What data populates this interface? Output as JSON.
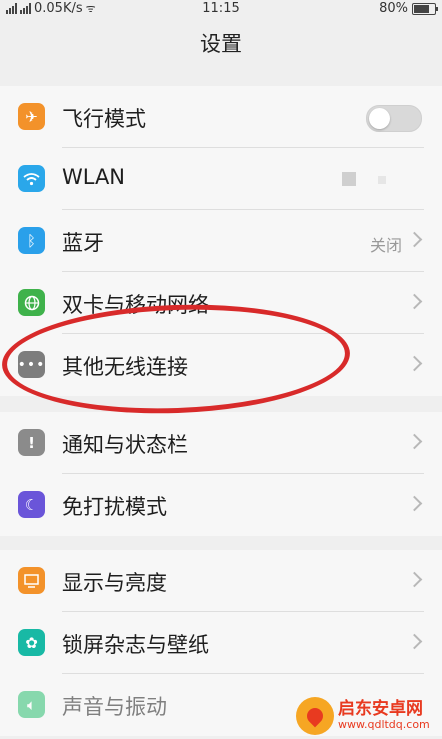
{
  "status_bar": {
    "network_speed": "0.05K/s",
    "time": "11:15",
    "battery": "80%",
    "battery_fraction": 0.8
  },
  "page_title": "设置",
  "groups": [
    {
      "items": [
        {
          "label": "飞行模式",
          "icon": "airplane-icon",
          "color": "#f3922a",
          "control": "toggle",
          "toggle_on": false
        },
        {
          "label": "WLAN",
          "icon": "wifi-icon",
          "color": "#2aa7ea",
          "control": "wifi"
        },
        {
          "label": "蓝牙",
          "icon": "bluetooth-icon",
          "color": "#2aa0ea",
          "value": "关闭",
          "control": "chevron"
        },
        {
          "label": "双卡与移动网络",
          "icon": "globe-icon",
          "color": "#3fb24b",
          "control": "chevron"
        },
        {
          "label": "其他无线连接",
          "icon": "more-icon",
          "color": "#7d7d7d",
          "control": "chevron"
        }
      ]
    },
    {
      "items": [
        {
          "label": "通知与状态栏",
          "icon": "exclamation-icon",
          "color": "#8b8b8b",
          "control": "chevron"
        },
        {
          "label": "免打扰模式",
          "icon": "moon-icon",
          "color": "#6a55d9",
          "control": "chevron"
        }
      ]
    },
    {
      "items": [
        {
          "label": "显示与亮度",
          "icon": "display-icon",
          "color": "#f3922a",
          "control": "chevron"
        },
        {
          "label": "锁屏杂志与壁纸",
          "icon": "flower-icon",
          "color": "#18b9a5",
          "control": "chevron"
        },
        {
          "label": "声音与振动",
          "icon": "sound-icon",
          "color": "#2dbf72",
          "control": "chevron"
        }
      ]
    }
  ],
  "watermark": {
    "name": "启东安卓网",
    "url": "www.qdltdq.com"
  }
}
